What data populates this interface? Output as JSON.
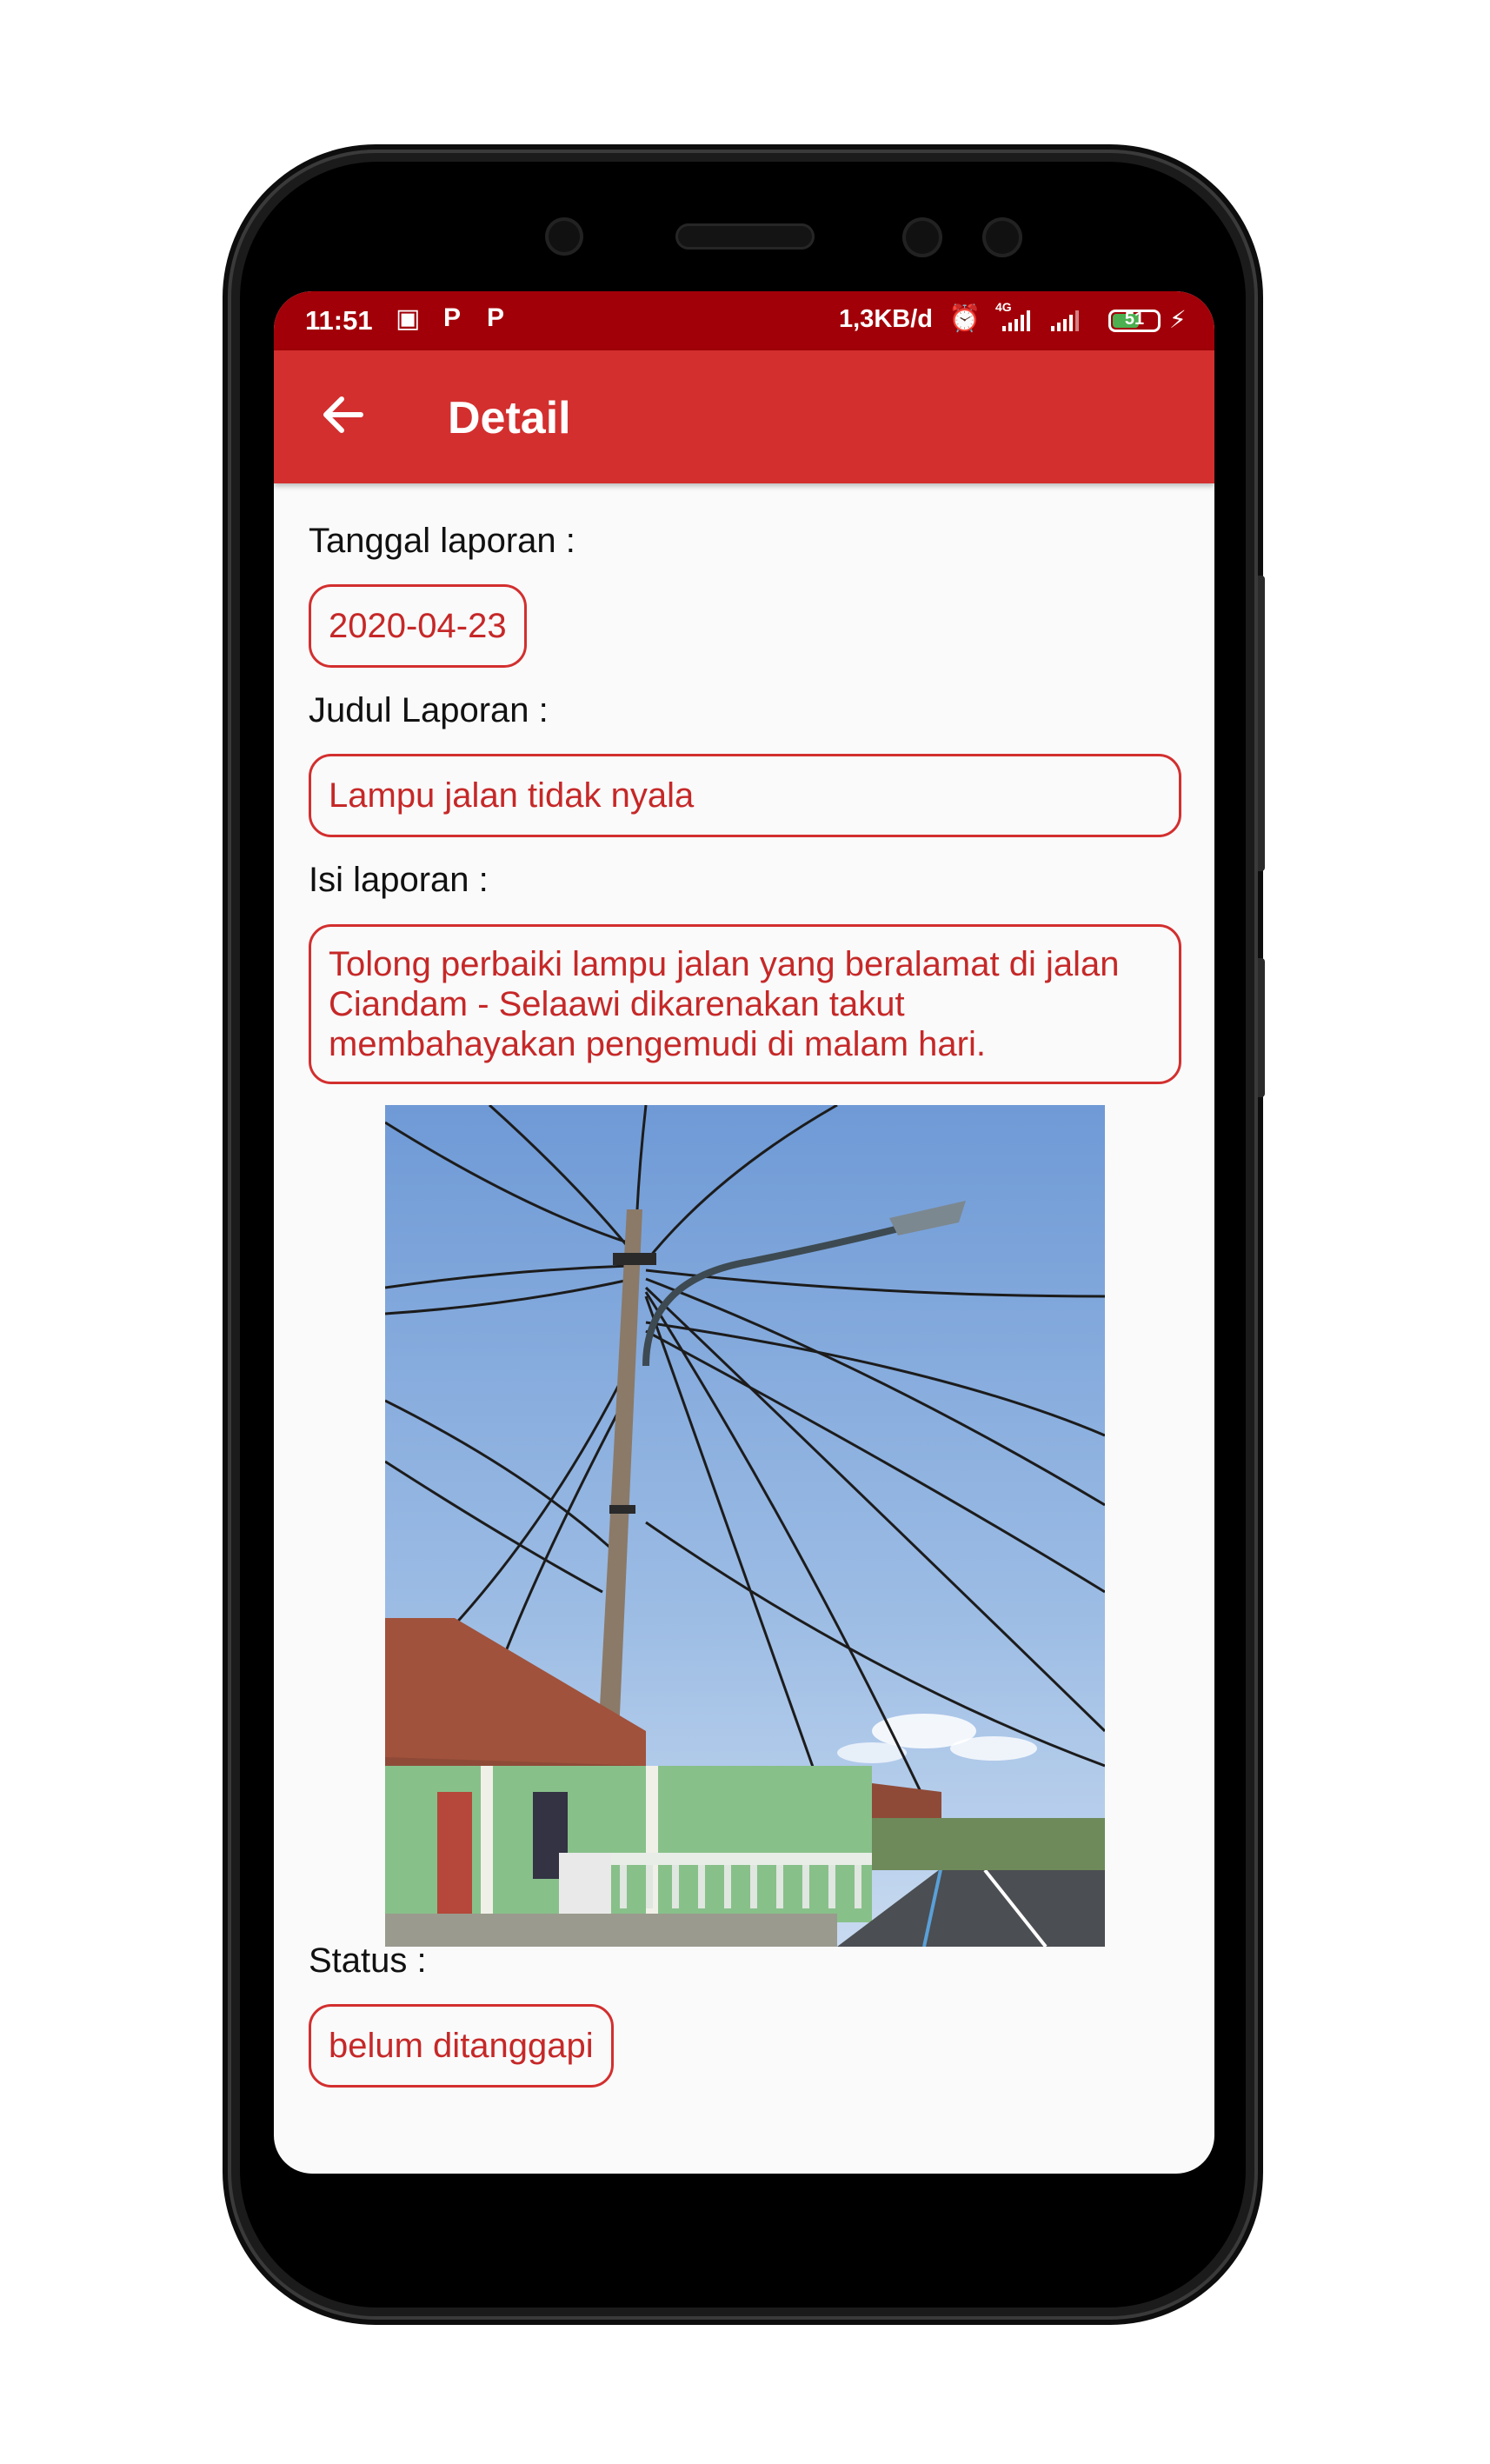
{
  "status_bar": {
    "time": "11:51",
    "speed": "1,3KB/d",
    "network": "4G",
    "battery": "51"
  },
  "app_bar": {
    "title": "Detail",
    "back_icon": "arrow-left-icon"
  },
  "report": {
    "date_label": "Tanggal laporan :",
    "date_value": "2020-04-23",
    "title_label": "Judul Laporan :",
    "title_value": "Lampu jalan tidak nyala",
    "content_label": "Isi laporan :",
    "content_value": "Tolong perbaiki lampu jalan yang beralamat di jalan Ciandam - Selaawi dikarenakan takut membahayakan pengemudi di malam hari.",
    "status_label": "Status :",
    "status_value": "belum ditanggapi"
  },
  "colors": {
    "primary": "#d32f2f",
    "primary_dark": "#a20008",
    "text_accent": "#c62828"
  }
}
